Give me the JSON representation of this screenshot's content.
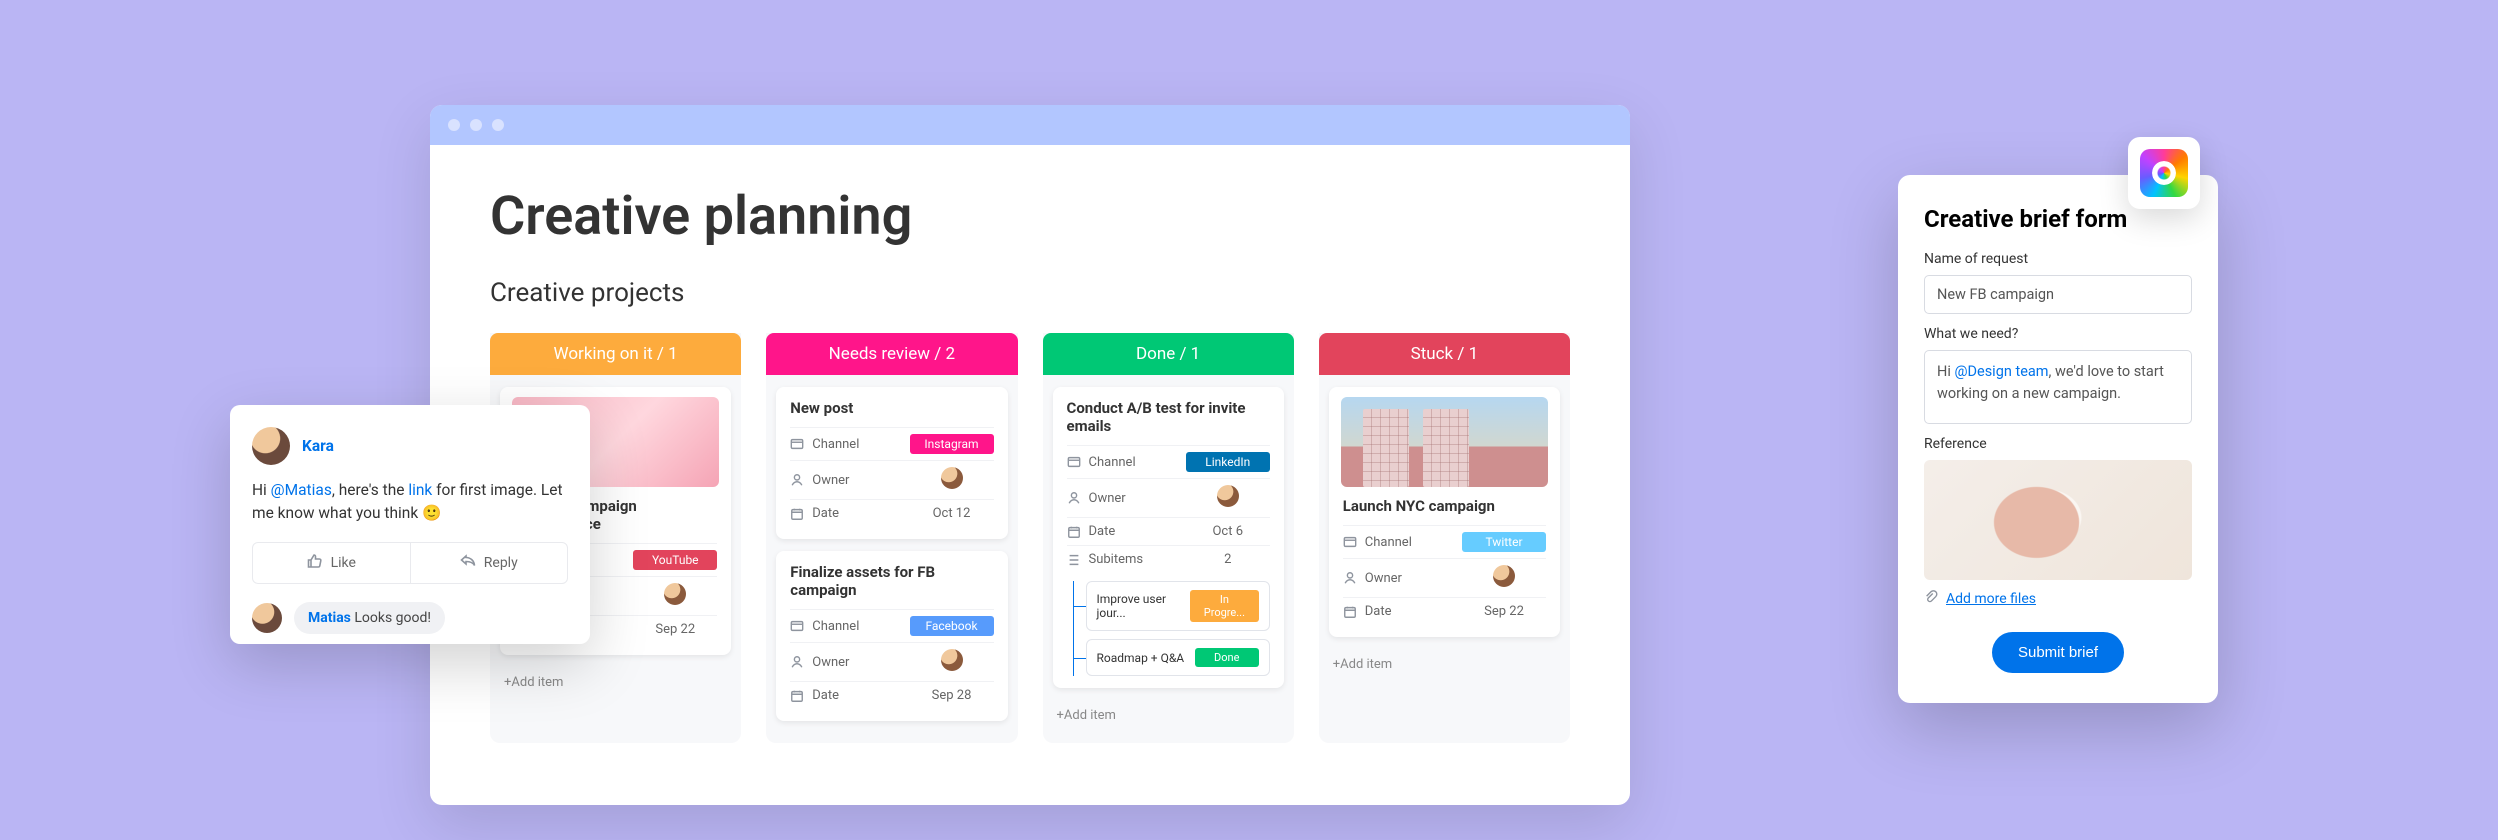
{
  "page": {
    "title": "Creative planning",
    "subtitle": "Creative projects"
  },
  "board": {
    "columns": [
      {
        "id": "working",
        "header": "Working on it / 1",
        "colorClass": "orange"
      },
      {
        "id": "review",
        "header": "Needs review / 2",
        "colorClass": "pink"
      },
      {
        "id": "done",
        "header": "Done / 1",
        "colorClass": "green"
      },
      {
        "id": "stuck",
        "header": "Stuck / 1",
        "colorClass": "red"
      }
    ],
    "addItem": "+Add item",
    "rowLabels": {
      "channel": "Channel",
      "owner": "Owner",
      "date": "Date",
      "subitems": "Subitems"
    },
    "cards": {
      "working": {
        "title": "Monitor campaign performance",
        "channel": "YouTube",
        "channelClass": "youtube",
        "date": "Sep 22"
      },
      "review1": {
        "title": "New post",
        "channel": "Instagram",
        "channelClass": "instagram",
        "date": "Oct 12"
      },
      "review2": {
        "title": "Finalize assets for FB campaign",
        "channel": "Facebook",
        "channelClass": "facebook",
        "date": "Sep 28"
      },
      "done": {
        "title": "Conduct A/B test for invite emails",
        "channel": "LinkedIn",
        "channelClass": "linkedin",
        "date": "Oct 6",
        "subitemsCount": "2",
        "sub1": {
          "title": "Improve user jour...",
          "status": "In Progre...",
          "statusClass": "inprog"
        },
        "sub2": {
          "title": "Roadmap + Q&A",
          "status": "Done",
          "statusClass": "done"
        }
      },
      "stuck": {
        "title": "Launch NYC campaign",
        "channel": "Twitter",
        "channelClass": "twitter",
        "date": "Sep 22"
      }
    }
  },
  "comment": {
    "name": "Kara",
    "body_pre": "Hi ",
    "mention": "@Matias",
    "body_mid": ", here's the ",
    "link": "link",
    "body_post": " for first image. Let me know what you think 🙂",
    "like": "Like",
    "reply": "Reply",
    "reply_name": "Matias",
    "reply_text": "Looks good!"
  },
  "form": {
    "title": "Creative brief form",
    "label_name": "Name of request",
    "value_name": "New FB campaign",
    "label_need": "What we need?",
    "need_pre": "Hi ",
    "need_mention": "@Design team",
    "need_post": ", we'd love to start working on a new campaign.",
    "label_ref": "Reference",
    "add_files": "Add more files",
    "submit": "Submit brief"
  }
}
